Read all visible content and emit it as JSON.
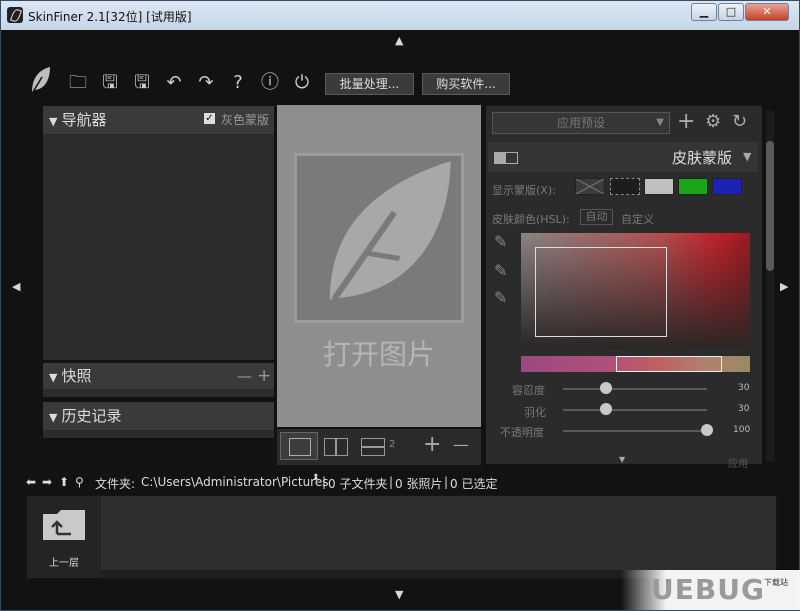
{
  "window": {
    "title": "SkinFiner 2.1[32位] [试用版]",
    "controls": {
      "minimize": "▁",
      "maximize": "□",
      "close": "✕"
    }
  },
  "toolbar": {
    "icons": [
      "feather-logo",
      "folder-open-icon",
      "save-icon",
      "save-as-icon",
      "undo-icon",
      "redo-icon",
      "help-icon",
      "info-icon",
      "plugin-icon"
    ],
    "batch_label": "批量处理...",
    "buy_label": "购买软件..."
  },
  "navigator": {
    "title": "导航器",
    "checkbox_label": "灰色蒙版",
    "checked": true
  },
  "snapshot": {
    "title": "快照",
    "minus": "—",
    "plus": "+"
  },
  "history": {
    "title": "历史记录"
  },
  "preview": {
    "open_label": "打开图片"
  },
  "preview_tools": {
    "compare_count": "2",
    "plus": "+",
    "minus": "—"
  },
  "right": {
    "preset_placeholder": "应用预设",
    "section_title": "皮肤蒙版",
    "show_mask_label": "显示蒙版(X):",
    "skin_color_label": "皮肤颜色(HSL):",
    "auto_label": "自动",
    "custom_label": "自定义",
    "swatch_colors": [
      "#3b3b3b",
      "#1d1d1d",
      "#c0c0c0",
      "#1aa51a",
      "#1a24b4"
    ],
    "sliders": [
      {
        "label": "容忍度",
        "value": "30",
        "fraction": 0.3
      },
      {
        "label": "羽化",
        "value": "30",
        "fraction": 0.3
      },
      {
        "label": "不透明度",
        "value": "100",
        "fraction": 1.0
      }
    ],
    "footer_label": "应用"
  },
  "pathbar": {
    "folder_label": "文件夹:",
    "path": "C:\\Users\\Administrator\\Pictures",
    "sep1": "|",
    "subfolders": "0 子文件夹",
    "sep2": "|",
    "photos": "0 张照片",
    "sep3": "|",
    "selected": "0 已选定"
  },
  "browser": {
    "up_label": "上一层"
  },
  "watermark": {
    "text": "UEBUG",
    "sub": "下载站"
  }
}
